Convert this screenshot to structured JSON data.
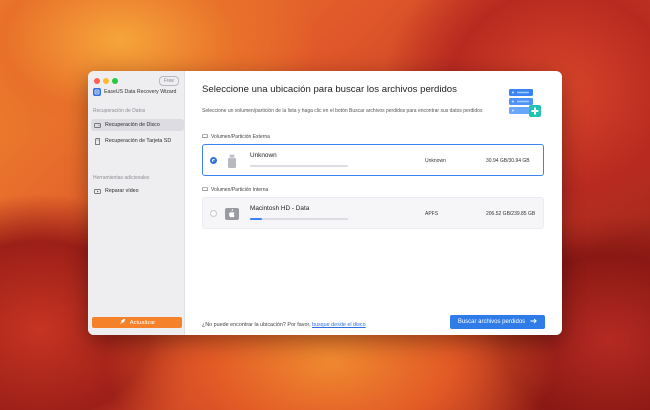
{
  "app": {
    "name": "EaseUS Data Recovery Wizard",
    "badge": "Free"
  },
  "sidebar": {
    "section_data": "Recuperación de Datos",
    "items": [
      {
        "label": "Recuperación de Disco",
        "active": true,
        "icon": "disk-icon"
      },
      {
        "label": "Recuperación de Tarjeta SD",
        "active": false,
        "icon": "sd-card-icon"
      }
    ],
    "section_tools": "Herramientas adicionales",
    "tools": [
      {
        "label": "Reparar vídeo",
        "icon": "video-repair-icon"
      }
    ],
    "update_label": "Actualizar"
  },
  "main": {
    "title": "Seleccione una ubicación para buscar los archivos perdidos",
    "subtitle": "Seleccione un volumen/partición de la lista y haga clic en el botón Buscar archivos perdidos para encontrar sus datos perdidos",
    "groups": [
      {
        "label": "Volumen/Partición Externa",
        "drives": [
          {
            "name": "Unknown",
            "fs": "Unknown",
            "size": "30.94 GB/30.94 GB",
            "selected": true,
            "usage": 0.0,
            "icon": "usb-drive-icon"
          }
        ]
      },
      {
        "label": "Volumen/Partición Interna",
        "drives": [
          {
            "name": "Macintosh HD - Data",
            "fs": "APFS",
            "size": "206.52 GB/239.85 GB",
            "selected": false,
            "usage": 0.12,
            "icon": "mac-disk-icon"
          }
        ]
      }
    ],
    "footer_prefix": "¿No puede encontrar la ubicación? Por favor,",
    "footer_link": "busque desde el disco",
    "scan_button": "Buscar archivos perdidos"
  },
  "colors": {
    "accent": "#2f7be8",
    "update": "#f5822a"
  }
}
